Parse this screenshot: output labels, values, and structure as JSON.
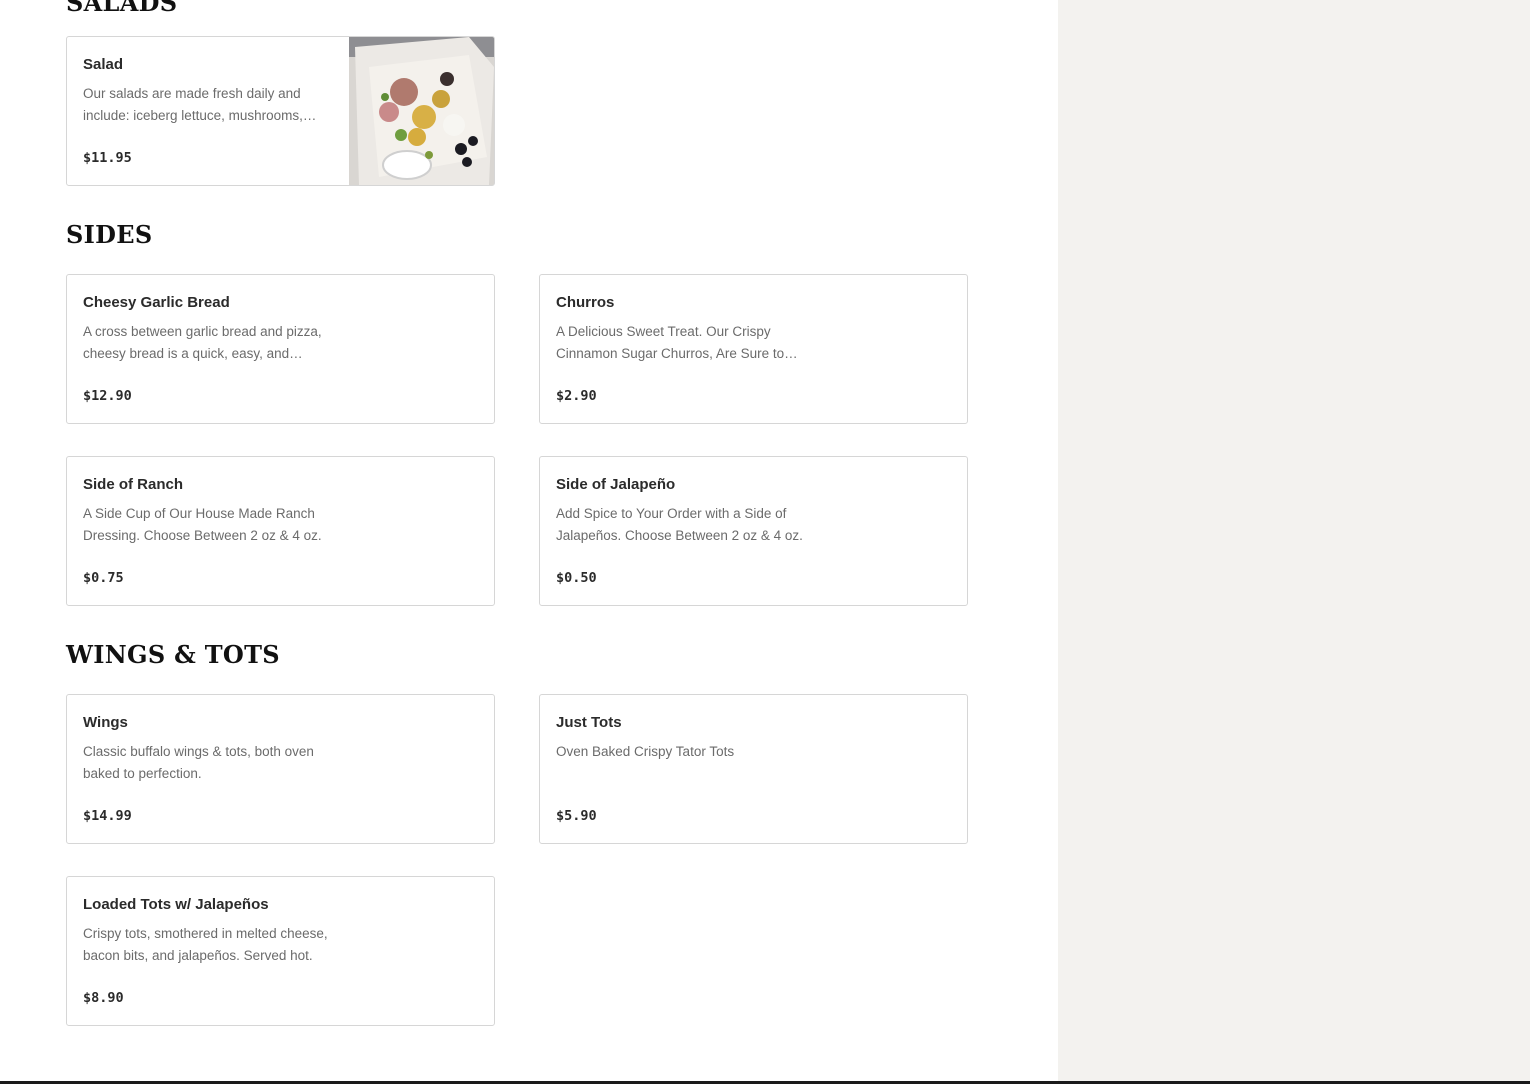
{
  "sections": {
    "salads": {
      "title": "SALADS",
      "items": [
        {
          "name": "Salad",
          "desc": "Our salads are made fresh daily and include: iceberg lettuce, mushrooms, tomatoes, cheese, and croutons.",
          "price": "$11.95",
          "image": "salad-photo"
        }
      ]
    },
    "sides": {
      "title": "SIDES",
      "items": [
        {
          "name": "Cheesy Garlic Bread",
          "desc": "A cross between garlic bread and pizza, cheesy bread is a quick, easy, and delicious side.",
          "price": "$12.90"
        },
        {
          "name": "Churros",
          "desc": "A Delicious Sweet Treat. Our Crispy Cinnamon Sugar Churros, Are Sure to satisfy.",
          "price": "$2.90"
        },
        {
          "name": "Side of Ranch",
          "desc": "A Side Cup of Our House Made Ranch Dressing. Choose Between 2 oz & 4 oz.",
          "price": "$0.75"
        },
        {
          "name": "Side of Jalapeño",
          "desc": "Add Spice to Your Order with a Side of Jalapeños. Choose Between 2 oz & 4 oz.",
          "price": "$0.50"
        }
      ]
    },
    "wings_tots": {
      "title": "WINGS & TOTS",
      "items": [
        {
          "name": "Wings",
          "desc": "Classic buffalo wings & tots, both oven baked to perfection.",
          "price": "$14.99"
        },
        {
          "name": "Just Tots",
          "desc": "Oven Baked Crispy Tator Tots",
          "price": "$5.90"
        },
        {
          "name": "Loaded Tots w/ Jalapeños",
          "desc": "Crispy tots, smothered in melted cheese, bacon bits, and jalapeños. Served hot.",
          "price": "$8.90"
        }
      ]
    }
  },
  "colors": {
    "right_panel_bg": "#f3f2ef",
    "card_border": "#d6d6d6",
    "desc_text": "#6b6b6b"
  }
}
